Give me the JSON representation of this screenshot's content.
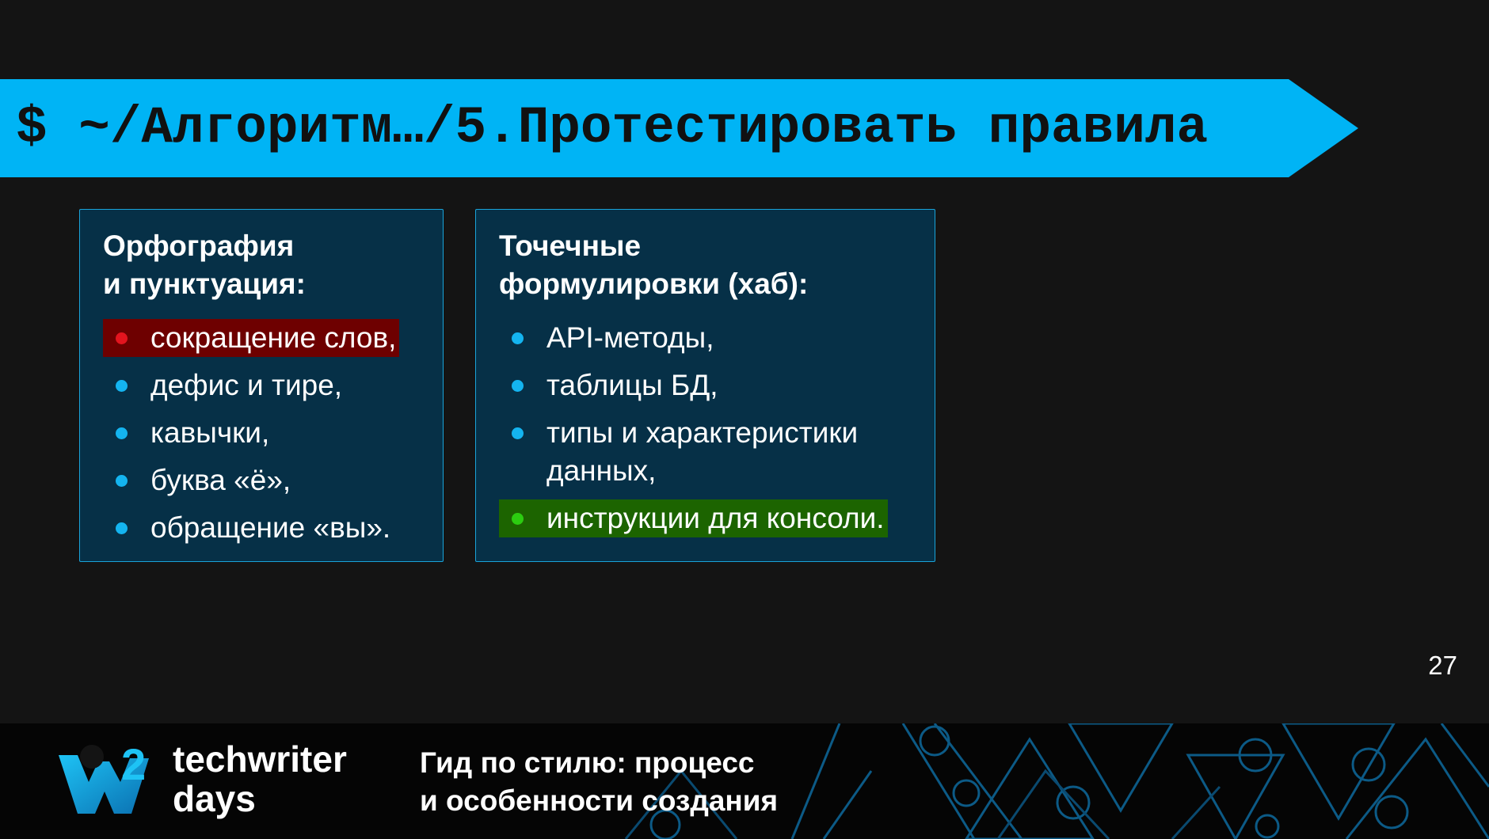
{
  "title": "$ ~/Алгоритм…/5.Протестировать правила",
  "cards": [
    {
      "title_lines": [
        "Орфография",
        "и пунктуация:"
      ],
      "items": [
        {
          "text": "сокращение слов,",
          "highlight": "#6e0000",
          "bullet_color": "#e2141e"
        },
        {
          "text": "дефис и тире,"
        },
        {
          "text": "кавычки,"
        },
        {
          "text": "буква «ё»,"
        },
        {
          "text": "обращение «вы»."
        }
      ]
    },
    {
      "title_lines": [
        "Точечные",
        "формулировки (хаб):"
      ],
      "items": [
        {
          "text": "API-методы,"
        },
        {
          "text": "таблицы БД,"
        },
        {
          "text": "типы и характеристики данных,"
        },
        {
          "text": "инструкции для консоли.",
          "highlight": "#1c6400",
          "bullet_color": "#2ccc10"
        }
      ]
    }
  ],
  "page_number": "27",
  "footer": {
    "brand_lines": [
      "techwriter",
      "days"
    ],
    "logo_number": "2",
    "subtitle_lines": [
      "Гид по стилю: процесс",
      "и особенности создания"
    ]
  },
  "colors": {
    "background": "#141414",
    "accent": "#00b4f5",
    "card_bg": "#063047",
    "bullet": "#14b4f0"
  }
}
